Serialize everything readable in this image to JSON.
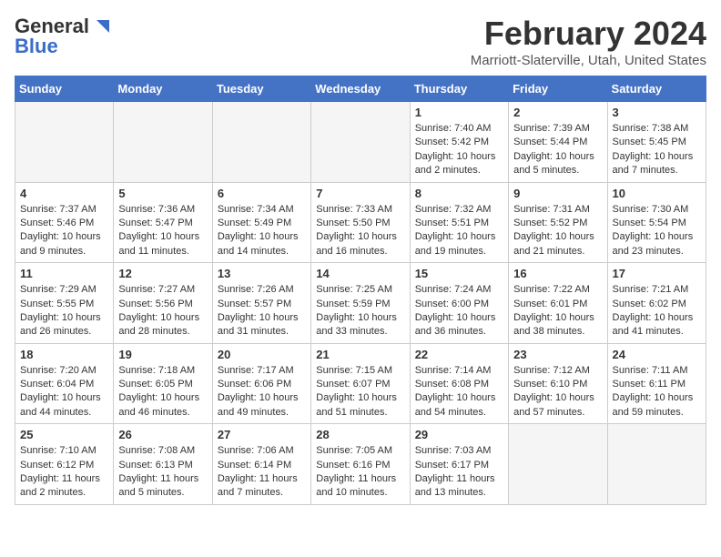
{
  "header": {
    "logo_general": "General",
    "logo_blue": "Blue",
    "month": "February 2024",
    "location": "Marriott-Slaterville, Utah, United States"
  },
  "days_of_week": [
    "Sunday",
    "Monday",
    "Tuesday",
    "Wednesday",
    "Thursday",
    "Friday",
    "Saturday"
  ],
  "weeks": [
    [
      {
        "day": "",
        "empty": true
      },
      {
        "day": "",
        "empty": true
      },
      {
        "day": "",
        "empty": true
      },
      {
        "day": "",
        "empty": true
      },
      {
        "day": "1",
        "sunrise": "7:40 AM",
        "sunset": "5:42 PM",
        "daylight": "Daylight: 10 hours and 2 minutes."
      },
      {
        "day": "2",
        "sunrise": "7:39 AM",
        "sunset": "5:44 PM",
        "daylight": "Daylight: 10 hours and 5 minutes."
      },
      {
        "day": "3",
        "sunrise": "7:38 AM",
        "sunset": "5:45 PM",
        "daylight": "Daylight: 10 hours and 7 minutes."
      }
    ],
    [
      {
        "day": "4",
        "sunrise": "7:37 AM",
        "sunset": "5:46 PM",
        "daylight": "Daylight: 10 hours and 9 minutes."
      },
      {
        "day": "5",
        "sunrise": "7:36 AM",
        "sunset": "5:47 PM",
        "daylight": "Daylight: 10 hours and 11 minutes."
      },
      {
        "day": "6",
        "sunrise": "7:34 AM",
        "sunset": "5:49 PM",
        "daylight": "Daylight: 10 hours and 14 minutes."
      },
      {
        "day": "7",
        "sunrise": "7:33 AM",
        "sunset": "5:50 PM",
        "daylight": "Daylight: 10 hours and 16 minutes."
      },
      {
        "day": "8",
        "sunrise": "7:32 AM",
        "sunset": "5:51 PM",
        "daylight": "Daylight: 10 hours and 19 minutes."
      },
      {
        "day": "9",
        "sunrise": "7:31 AM",
        "sunset": "5:52 PM",
        "daylight": "Daylight: 10 hours and 21 minutes."
      },
      {
        "day": "10",
        "sunrise": "7:30 AM",
        "sunset": "5:54 PM",
        "daylight": "Daylight: 10 hours and 23 minutes."
      }
    ],
    [
      {
        "day": "11",
        "sunrise": "7:29 AM",
        "sunset": "5:55 PM",
        "daylight": "Daylight: 10 hours and 26 minutes."
      },
      {
        "day": "12",
        "sunrise": "7:27 AM",
        "sunset": "5:56 PM",
        "daylight": "Daylight: 10 hours and 28 minutes."
      },
      {
        "day": "13",
        "sunrise": "7:26 AM",
        "sunset": "5:57 PM",
        "daylight": "Daylight: 10 hours and 31 minutes."
      },
      {
        "day": "14",
        "sunrise": "7:25 AM",
        "sunset": "5:59 PM",
        "daylight": "Daylight: 10 hours and 33 minutes."
      },
      {
        "day": "15",
        "sunrise": "7:24 AM",
        "sunset": "6:00 PM",
        "daylight": "Daylight: 10 hours and 36 minutes."
      },
      {
        "day": "16",
        "sunrise": "7:22 AM",
        "sunset": "6:01 PM",
        "daylight": "Daylight: 10 hours and 38 minutes."
      },
      {
        "day": "17",
        "sunrise": "7:21 AM",
        "sunset": "6:02 PM",
        "daylight": "Daylight: 10 hours and 41 minutes."
      }
    ],
    [
      {
        "day": "18",
        "sunrise": "7:20 AM",
        "sunset": "6:04 PM",
        "daylight": "Daylight: 10 hours and 44 minutes."
      },
      {
        "day": "19",
        "sunrise": "7:18 AM",
        "sunset": "6:05 PM",
        "daylight": "Daylight: 10 hours and 46 minutes."
      },
      {
        "day": "20",
        "sunrise": "7:17 AM",
        "sunset": "6:06 PM",
        "daylight": "Daylight: 10 hours and 49 minutes."
      },
      {
        "day": "21",
        "sunrise": "7:15 AM",
        "sunset": "6:07 PM",
        "daylight": "Daylight: 10 hours and 51 minutes."
      },
      {
        "day": "22",
        "sunrise": "7:14 AM",
        "sunset": "6:08 PM",
        "daylight": "Daylight: 10 hours and 54 minutes."
      },
      {
        "day": "23",
        "sunrise": "7:12 AM",
        "sunset": "6:10 PM",
        "daylight": "Daylight: 10 hours and 57 minutes."
      },
      {
        "day": "24",
        "sunrise": "7:11 AM",
        "sunset": "6:11 PM",
        "daylight": "Daylight: 10 hours and 59 minutes."
      }
    ],
    [
      {
        "day": "25",
        "sunrise": "7:10 AM",
        "sunset": "6:12 PM",
        "daylight": "Daylight: 11 hours and 2 minutes."
      },
      {
        "day": "26",
        "sunrise": "7:08 AM",
        "sunset": "6:13 PM",
        "daylight": "Daylight: 11 hours and 5 minutes."
      },
      {
        "day": "27",
        "sunrise": "7:06 AM",
        "sunset": "6:14 PM",
        "daylight": "Daylight: 11 hours and 7 minutes."
      },
      {
        "day": "28",
        "sunrise": "7:05 AM",
        "sunset": "6:16 PM",
        "daylight": "Daylight: 11 hours and 10 minutes."
      },
      {
        "day": "29",
        "sunrise": "7:03 AM",
        "sunset": "6:17 PM",
        "daylight": "Daylight: 11 hours and 13 minutes."
      },
      {
        "day": "",
        "empty": true
      },
      {
        "day": "",
        "empty": true
      }
    ]
  ]
}
